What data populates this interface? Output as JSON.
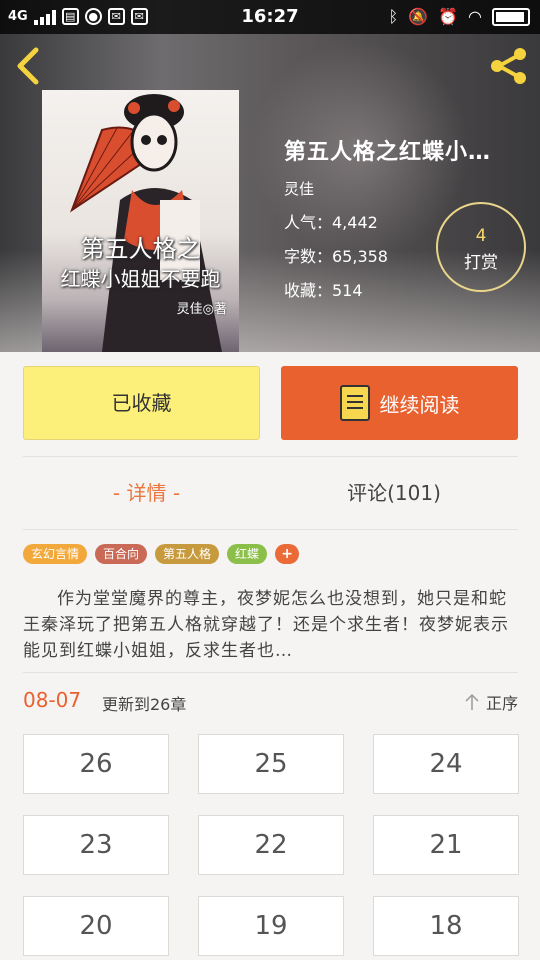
{
  "status_bar": {
    "network": "4G",
    "time": "16:27"
  },
  "book": {
    "title": "第五人格之红蝶小…",
    "author": "灵佳",
    "popularity": "人气：4,442",
    "word_count": "字数：65,358",
    "favorites": "收藏：514",
    "cover_title_line1": "第五人格之",
    "cover_title_line2": "红蝶小姐姐不要跑",
    "cover_author": "灵佳◎著"
  },
  "reward": {
    "count": "4",
    "label": "打赏"
  },
  "actions": {
    "favorited_label": "已收藏",
    "continue_label": "继续阅读"
  },
  "tabs": {
    "details": "- 详情 -",
    "comments": "评论(101)"
  },
  "tags": [
    {
      "label": "玄幻言情",
      "color": "#f2a83a"
    },
    {
      "label": "百合向",
      "color": "#c86a55"
    },
    {
      "label": "第五人格",
      "color": "#c79a3e"
    },
    {
      "label": "红蝶",
      "color": "#8cbf4a"
    }
  ],
  "tag_add": "+",
  "summary": "作为堂堂魔界的尊主，夜梦妮怎么也没想到，她只是和蛇王秦泽玩了把第五人格就穿越了！还是个求生者！夜梦妮表示能见到红蝶小姐姐，反求生者也…",
  "update": {
    "date": "08-07",
    "text": "更新到26章",
    "sort_label": "正序"
  },
  "chapters": [
    "26",
    "25",
    "24",
    "23",
    "22",
    "21",
    "20",
    "19",
    "18"
  ]
}
